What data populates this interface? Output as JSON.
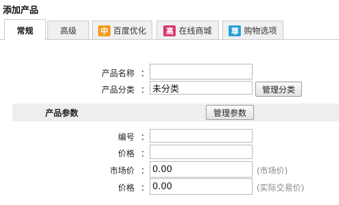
{
  "page": {
    "title": "添加产品"
  },
  "tabs": [
    {
      "label": "常规",
      "active": true
    },
    {
      "label": "高级"
    },
    {
      "label": "百度优化",
      "badge": "中",
      "badge_color": "#f39a1e"
    },
    {
      "label": "在线商城",
      "badge": "高",
      "badge_color": "#d93a6b"
    },
    {
      "label": "购物选项",
      "badge": "尊",
      "badge_color": "#2a9fd6"
    }
  ],
  "form": {
    "colon": "：",
    "name_label": "产品名称",
    "name_value": "",
    "category_label": "产品分类",
    "category_value": "未分类",
    "manage_category_button": "管理分类"
  },
  "params_section": {
    "title": "产品参数",
    "manage_params_button": "管理参数"
  },
  "params": {
    "code_label": "编号",
    "code_value": "",
    "price_label": "价格",
    "price_value": "",
    "market_price_label": "市场价",
    "market_price_value": "0.00",
    "market_price_hint": "(市场价)",
    "actual_price_label": "价格",
    "actual_price_value": "0.00",
    "actual_price_hint": "(实际交易价)"
  }
}
